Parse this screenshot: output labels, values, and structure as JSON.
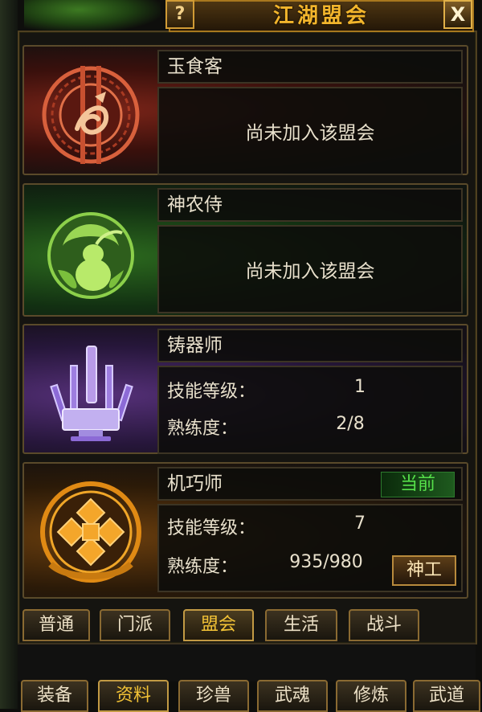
{
  "window": {
    "title": "江湖盟会",
    "help_label": "?",
    "close_label": "X"
  },
  "guilds": [
    {
      "name": "玉食客",
      "status_text": "尚未加入该盟会",
      "emblem": "jade-fish-emblem-icon",
      "accent": "#c0482c"
    },
    {
      "name": "神农侍",
      "status_text": "尚未加入该盟会",
      "emblem": "herb-gourd-emblem-icon",
      "accent": "#7fc43e"
    },
    {
      "name": "铸器师",
      "skill_level_label": "技能等级：",
      "skill_level": "1",
      "proficiency_label": "熟练度：",
      "proficiency": "2/8",
      "emblem": "forge-weapons-emblem-icon",
      "accent": "#9a78d8"
    },
    {
      "name": "机巧师",
      "badge": "当前",
      "skill_level_label": "技能等级：",
      "skill_level": "7",
      "proficiency_label": "熟练度：",
      "proficiency": "935/980",
      "button_label": "神工",
      "emblem": "mechanism-gear-emblem-icon",
      "accent": "#e89a1c"
    }
  ],
  "tabs": [
    {
      "label": "普通",
      "active": false
    },
    {
      "label": "门派",
      "active": false
    },
    {
      "label": "盟会",
      "active": true
    },
    {
      "label": "生活",
      "active": false
    },
    {
      "label": "战斗",
      "active": false
    }
  ],
  "bottom_tabs": [
    {
      "label": "装备",
      "active": false
    },
    {
      "label": "资料",
      "active": true
    },
    {
      "label": "珍兽",
      "active": false
    },
    {
      "label": "武魂",
      "active": false
    },
    {
      "label": "修炼",
      "active": false
    },
    {
      "label": "武道",
      "active": false
    }
  ]
}
